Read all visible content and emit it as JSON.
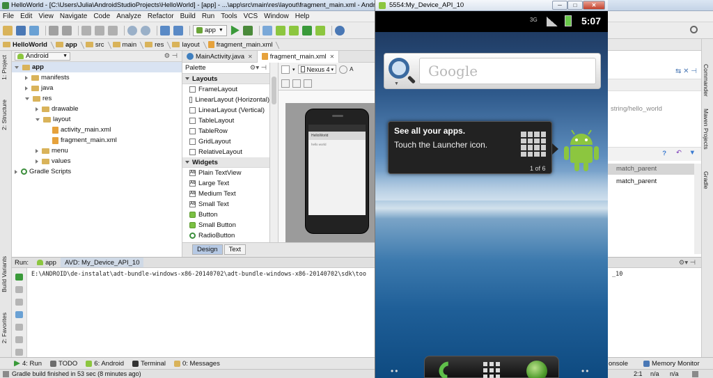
{
  "window": {
    "title": "HelloWorld - [C:\\Users\\Julia\\AndroidStudioProjects\\HelloWorld] - [app] - ...\\app\\src\\main\\res\\layout\\fragment_main.xml - Android"
  },
  "menu": [
    "File",
    "Edit",
    "View",
    "Navigate",
    "Code",
    "Analyze",
    "Refactor",
    "Build",
    "Run",
    "Tools",
    "VCS",
    "Window",
    "Help"
  ],
  "toolbar": {
    "run_config": "app"
  },
  "breadcrumbs": [
    "HelloWorld",
    "app",
    "src",
    "main",
    "res",
    "layout",
    "fragment_main.xml"
  ],
  "left_strip": {
    "project": "1: Project",
    "structure": "2: Structure",
    "build_variants": "Build Variants",
    "favorites": "2: Favorites"
  },
  "project_panel": {
    "view_selector": "Android",
    "tree": [
      {
        "label": "app",
        "level": 0,
        "type": "folder",
        "open": true,
        "selected": true
      },
      {
        "label": "manifests",
        "level": 1,
        "type": "folder",
        "open": false
      },
      {
        "label": "java",
        "level": 1,
        "type": "folder",
        "open": false
      },
      {
        "label": "res",
        "level": 1,
        "type": "folder",
        "open": true
      },
      {
        "label": "drawable",
        "level": 2,
        "type": "folder",
        "open": false
      },
      {
        "label": "layout",
        "level": 2,
        "type": "folder",
        "open": true
      },
      {
        "label": "activity_main.xml",
        "level": 3,
        "type": "xml"
      },
      {
        "label": "fragment_main.xml",
        "level": 3,
        "type": "xml"
      },
      {
        "label": "menu",
        "level": 2,
        "type": "folder",
        "open": false
      },
      {
        "label": "values",
        "level": 2,
        "type": "folder",
        "open": false
      },
      {
        "label": "Gradle Scripts",
        "level": 0,
        "type": "gradle",
        "open": false
      }
    ]
  },
  "editor_tabs": [
    {
      "label": "MainActivity.java",
      "active": false
    },
    {
      "label": "fragment_main.xml",
      "active": true
    }
  ],
  "palette": {
    "title": "Palette",
    "sections": [
      {
        "name": "Layouts",
        "items": [
          "FrameLayout",
          "LinearLayout (Horizontal)",
          "LinearLayout (Vertical)",
          "TableLayout",
          "TableRow",
          "GridLayout",
          "RelativeLayout"
        ]
      },
      {
        "name": "Widgets",
        "items": [
          "Plain TextView",
          "Large Text",
          "Medium Text",
          "Small Text",
          "Button",
          "Small Button",
          "RadioButton"
        ]
      }
    ]
  },
  "design_toolbar": {
    "device": "Nexus 4"
  },
  "preview": {
    "app_name": "HelloWorld",
    "text": "hello world"
  },
  "design_tabs": [
    {
      "label": "Design",
      "active": true
    },
    {
      "label": "Text",
      "active": false
    }
  ],
  "right_panel": {
    "string_value": "string/hello_world",
    "prop1": "match_parent",
    "prop2": "match_parent"
  },
  "right_strip": {
    "commander": "Commander",
    "maven": "Maven Projects",
    "gradle": "Gradle"
  },
  "run": {
    "label": "Run:",
    "tabs": [
      {
        "label": "app",
        "active": false
      },
      {
        "label": "AVD: My_Device_API_10",
        "active": true
      }
    ],
    "console_line": "E:\\ANDROID\\de-instalat\\adt-bundle-windows-x86-20140702\\adt-bundle-windows-x86-20140702\\sdk\\too",
    "console_line_end": "_10"
  },
  "bottom_tabs": [
    {
      "label": "4: Run",
      "color": "#3a9a3a"
    },
    {
      "label": "TODO",
      "color": "#6d6d6d"
    },
    {
      "label": "6: Android",
      "color": "#8cc63f"
    },
    {
      "label": "Terminal",
      "color": "#333333"
    },
    {
      "label": "0: Messages",
      "color": "#d9b35a"
    }
  ],
  "bottom_right_tabs": [
    {
      "label": "onsole"
    },
    {
      "label": "Memory Monitor"
    }
  ],
  "status": {
    "message": "Gradle build finished in 53 sec (8 minutes ago)",
    "position": "2:1",
    "sep1": "n/a",
    "sep2": "n/a"
  },
  "emulator": {
    "title": "5554:My_Device_API_10",
    "network": "3G",
    "time": "5:07",
    "search_hint": "Google",
    "tip_title": "See all your apps.",
    "tip_text": "Touch the Launcher icon.",
    "tip_count": "1 of 6"
  }
}
